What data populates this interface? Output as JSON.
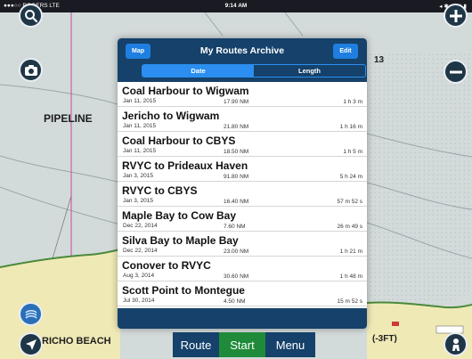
{
  "status_bar": {
    "carrier": "●●●○○ ROGERS  LTE",
    "time": "9:14 AM",
    "battery": "◂ ✱ 44% ▮"
  },
  "map": {
    "labels": {
      "pipeline": "PIPELINE",
      "beach": "RICHO BEACH",
      "depth_13": "13",
      "depth_3ft": "(-3FT)"
    },
    "colors": {
      "water": "#d3dada",
      "land": "#efe9b6",
      "dots": "#8fa7b3",
      "pipeline": "#c04aa6"
    }
  },
  "routes_panel": {
    "title": "My Routes Archive",
    "map_button": "Map",
    "edit_button": "Edit",
    "sort_tabs": [
      {
        "label": "Date",
        "active": true
      },
      {
        "label": "Length",
        "active": false
      }
    ],
    "routes": [
      {
        "name": "Coal Harbour to Wigwam",
        "date": "Jan 11, 2015",
        "distance": "17.90 NM",
        "duration": "1 h 3 m"
      },
      {
        "name": "Jericho to Wigwam",
        "date": "Jan 11, 2015",
        "distance": "21.80 NM",
        "duration": "1 h 16 m"
      },
      {
        "name": "Coal Harbour to CBYS",
        "date": "Jan 11, 2015",
        "distance": "18.50 NM",
        "duration": "1 h 5 m"
      },
      {
        "name": "RVYC to Prideaux Haven",
        "date": "Jan 3, 2015",
        "distance": "91.80 NM",
        "duration": "5 h 24 m"
      },
      {
        "name": "RVYC to CBYS",
        "date": "Jan 3, 2015",
        "distance": "16.40 NM",
        "duration": "57 m 52 s"
      },
      {
        "name": "Maple Bay to Cow Bay",
        "date": "Dec 22, 2014",
        "distance": "7.60 NM",
        "duration": "26 m 49 s"
      },
      {
        "name": "Silva Bay to Maple Bay",
        "date": "Dec 22, 2014",
        "distance": "23.00 NM",
        "duration": "1 h 21 m"
      },
      {
        "name": "Conover to RVYC",
        "date": "Aug 3, 2014",
        "distance": "30.60 NM",
        "duration": "1 h 48 m"
      },
      {
        "name": "Scott Point to Montegue",
        "date": "Jul 30, 2014",
        "distance": "4.50 NM",
        "duration": "15 m 52 s"
      }
    ]
  },
  "toolbar": {
    "route_label": "Route",
    "start_label": "Start",
    "menu_label": "Menu",
    "start_color": "#1f8b3a",
    "bar_color": "#15416a"
  },
  "icons": {
    "search": "search-icon",
    "camera": "camera-icon",
    "zoom_in": "plus-icon",
    "zoom_out": "minus-icon",
    "layers": "layers-icon",
    "locate": "location-arrow-icon",
    "person": "person-icon"
  }
}
